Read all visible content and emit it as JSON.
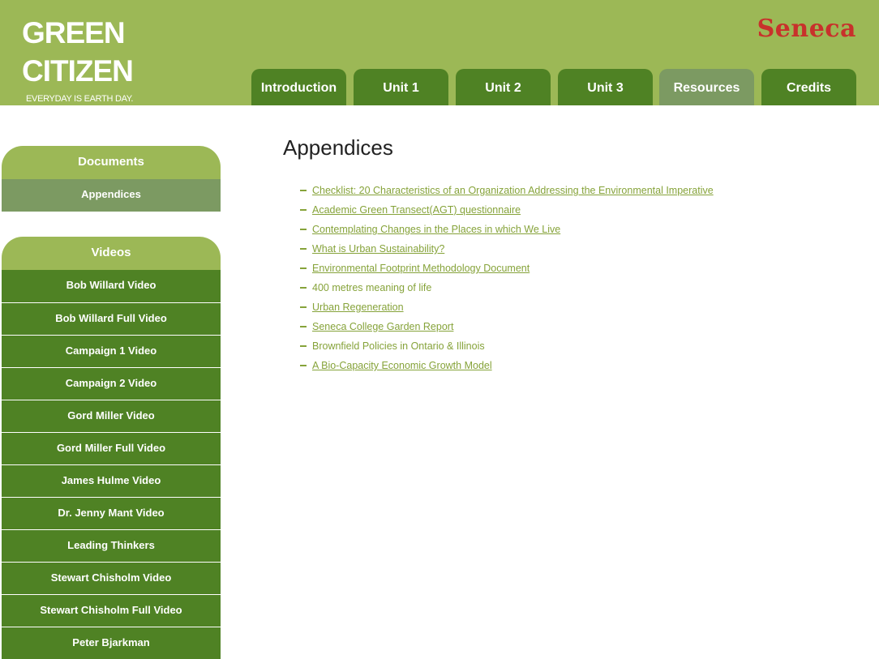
{
  "header": {
    "logo_line1": "GREEN",
    "logo_line2": "CITIZEN",
    "tagline": "EVERYDAY IS EARTH DAY.",
    "brand": "Seneca",
    "colors": {
      "header_bg": "#9cb856",
      "tab_bg": "#4f8224",
      "tab_active_bg": "#7c9a62",
      "brand": "#c8312b"
    }
  },
  "nav": {
    "tabs": [
      {
        "label": "Introduction",
        "active": false
      },
      {
        "label": "Unit 1",
        "active": false
      },
      {
        "label": "Unit 2",
        "active": false
      },
      {
        "label": "Unit 3",
        "active": false
      },
      {
        "label": "Resources",
        "active": true
      },
      {
        "label": "Credits",
        "active": false
      }
    ]
  },
  "sidebar": {
    "documents": {
      "title": "Documents",
      "items": [
        "Appendices"
      ]
    },
    "videos": {
      "title": "Videos",
      "items": [
        "Bob Willard Video",
        "Bob Willard Full Video",
        "Campaign 1 Video",
        "Campaign 2 Video",
        "Gord Miller Video",
        "Gord Miller Full Video",
        "James Hulme Video",
        "Dr. Jenny Mant Video",
        "Leading Thinkers",
        "Stewart Chisholm Video",
        "Stewart Chisholm Full Video",
        "Peter Bjarkman"
      ]
    }
  },
  "main": {
    "title": "Appendices",
    "links": [
      {
        "text": "Checklist: 20 Characteristics of an Organization Addressing the Environmental Imperative",
        "linked": true
      },
      {
        "text": "Academic Green Transect(AGT) questionnaire",
        "linked": true
      },
      {
        "text": "Contemplating Changes in the Places in which We Live",
        "linked": true
      },
      {
        "text": "What is Urban Sustainability?",
        "linked": true
      },
      {
        "text": "Environmental Footprint Methodology Document",
        "linked": true
      },
      {
        "text": "400 metres meaning of life",
        "linked": false
      },
      {
        "text": "Urban Regeneration",
        "linked": true
      },
      {
        "text": "Seneca College Garden Report",
        "linked": true
      },
      {
        "text": "Brownfield Policies in Ontario & Illinois",
        "linked": false
      },
      {
        "text": "A Bio-Capacity Economic Growth Model",
        "linked": true
      }
    ],
    "link_color": "#86a33a"
  }
}
